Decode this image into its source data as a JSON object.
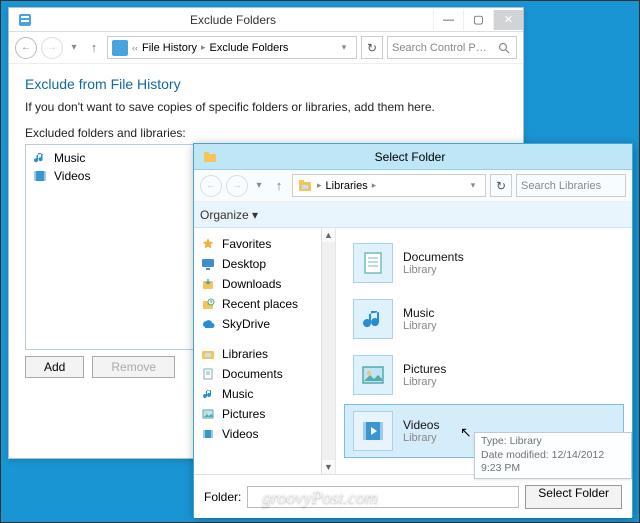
{
  "win1": {
    "title": "Exclude Folders",
    "breadcrumb": {
      "a": "File History",
      "b": "Exclude Folders"
    },
    "search_placeholder": "Search Control P…",
    "heading": "Exclude from File History",
    "subtext": "If you don't want to save copies of specific folders or libraries, add them here.",
    "list_label": "Excluded folders and libraries:",
    "items": [
      {
        "label": "Music"
      },
      {
        "label": "Videos"
      }
    ],
    "add": "Add",
    "remove": "Remove"
  },
  "win2": {
    "title": "Select Folder",
    "breadcrumb": {
      "a": "Libraries"
    },
    "search_placeholder": "Search Libraries",
    "organize": "Organize",
    "tree": {
      "favorites": "Favorites",
      "fav_items": [
        "Desktop",
        "Downloads",
        "Recent places",
        "SkyDrive"
      ],
      "libraries": "Libraries",
      "lib_items": [
        "Documents",
        "Music",
        "Pictures",
        "Videos"
      ]
    },
    "libs": [
      {
        "name": "Documents",
        "sub": "Library"
      },
      {
        "name": "Music",
        "sub": "Library"
      },
      {
        "name": "Pictures",
        "sub": "Library"
      },
      {
        "name": "Videos",
        "sub": "Library"
      }
    ],
    "tooltip": {
      "l1": "Type: Library",
      "l2": "Date modified: 12/14/2012 9:23 PM"
    },
    "folder_label": "Folder:",
    "select_btn": "Select Folder"
  },
  "watermark": "groovyPost.com",
  "icons": {
    "music": "note",
    "videos": "film",
    "desktop": "monitor",
    "downloads": "down",
    "recent": "clock",
    "skydrive": "cloud",
    "documents": "doc",
    "pictures": "pic",
    "favorites": "star",
    "libraries": "stack",
    "search": "mag"
  },
  "colors": {
    "accent": "#1a95d4",
    "sel": "#d5ecfb",
    "heading": "#126a9f"
  }
}
